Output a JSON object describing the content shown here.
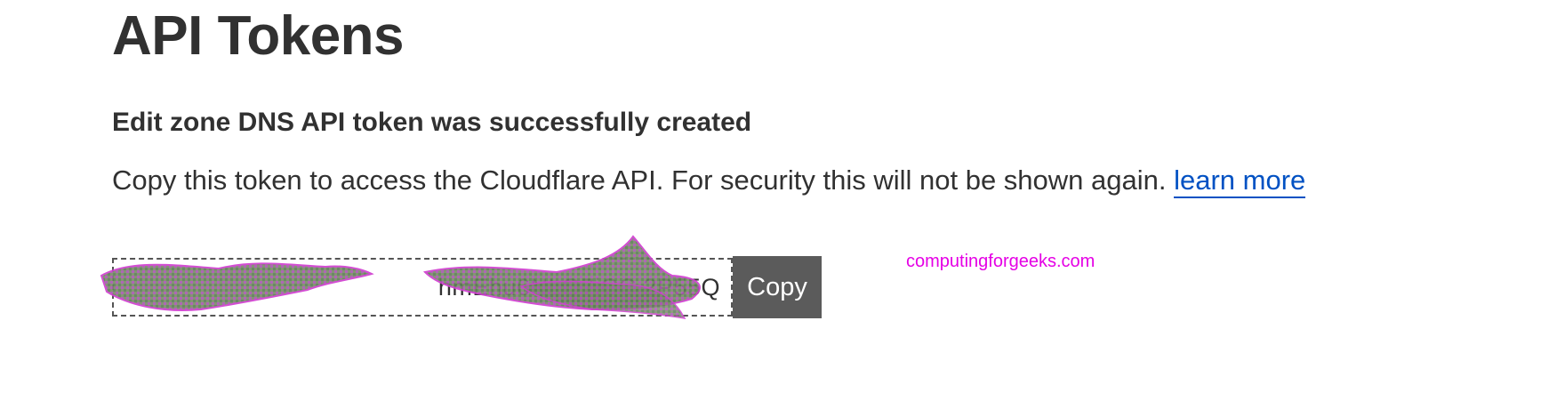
{
  "page": {
    "title": "API Tokens",
    "subtitle": "Edit zone DNS API token was successfully created",
    "description": "Copy this token to access the Cloudflare API. For security this will not be shown again.",
    "learn_more_label": "learn more"
  },
  "token": {
    "visible_fragment": "hmEhu6NLQ7jCC                2P55Q",
    "redacted": true
  },
  "actions": {
    "copy_label": "Copy"
  },
  "watermark": {
    "text": "computingforgeeks.com"
  },
  "colors": {
    "text": "#313131",
    "link": "#0051c3",
    "button_bg": "#5b5b5b",
    "watermark": "#e500e5"
  }
}
